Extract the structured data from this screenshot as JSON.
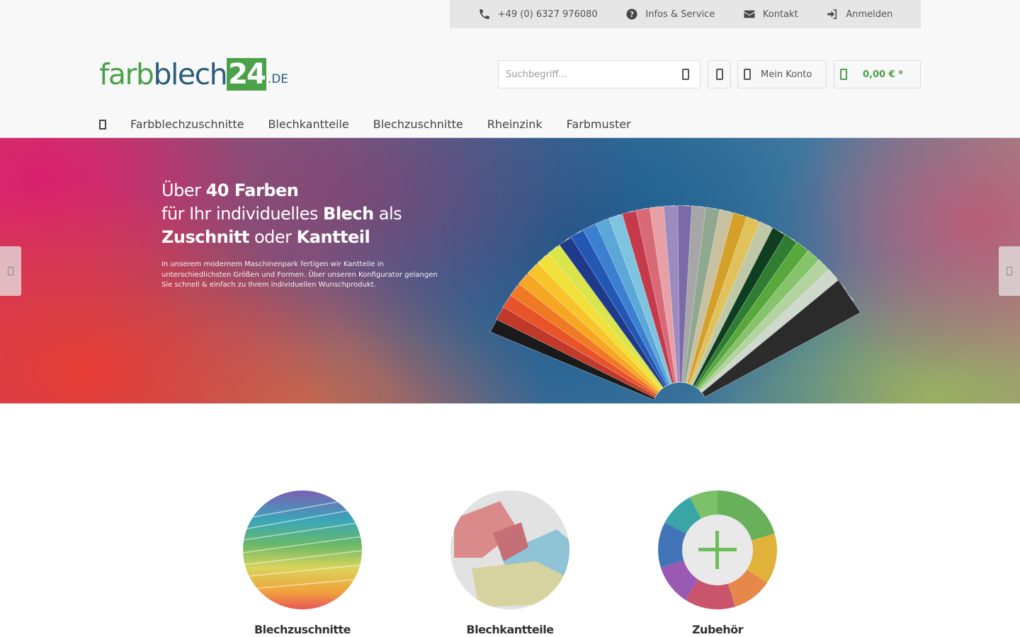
{
  "topbar": {
    "phone": "+49 (0) 6327 976080",
    "infos": "Infos & Service",
    "kontakt": "Kontakt",
    "anmelden": "Anmelden"
  },
  "logo": {
    "part1": "farb",
    "part2": "blech",
    "part3": "24",
    "part4": ".DE"
  },
  "search": {
    "placeholder": "Suchbegriff..."
  },
  "header": {
    "account_label": "Mein Konto",
    "cart_total": "0,00 € *"
  },
  "nav": {
    "items": [
      "Farbblechzuschnitte",
      "Blechkantteile",
      "Blechzuschnitte",
      "Rheinzink",
      "Farbmuster"
    ]
  },
  "hero": {
    "line1_a": "Über ",
    "line1_b": "40 Farben",
    "line2_a": "für Ihr individuelles ",
    "line2_b": "Blech",
    "line2_c": " als",
    "line3_a": "Zuschnitt",
    "line3_b": " oder ",
    "line3_c": "Kantteil",
    "sub": "In unserem modernem Maschinenpark fertigen wir Kantteile in unterschiedlichsten Größen und Formen. Über unseren Konfigurator gelangen Sie schnell & einfach zu Ihrem individuellen Wunschprodukt."
  },
  "categories": [
    {
      "label": "Blechzuschnitte"
    },
    {
      "label": "Blechkantteile"
    },
    {
      "label": "Zubehör"
    }
  ],
  "colors": {
    "brand_green": "#4aa148",
    "brand_blue": "#2b5c7c"
  },
  "icons": [
    "phone-icon",
    "help-icon",
    "mail-icon",
    "login-icon",
    "search-icon",
    "wishlist-icon",
    "account-icon",
    "cart-icon",
    "home-icon"
  ]
}
